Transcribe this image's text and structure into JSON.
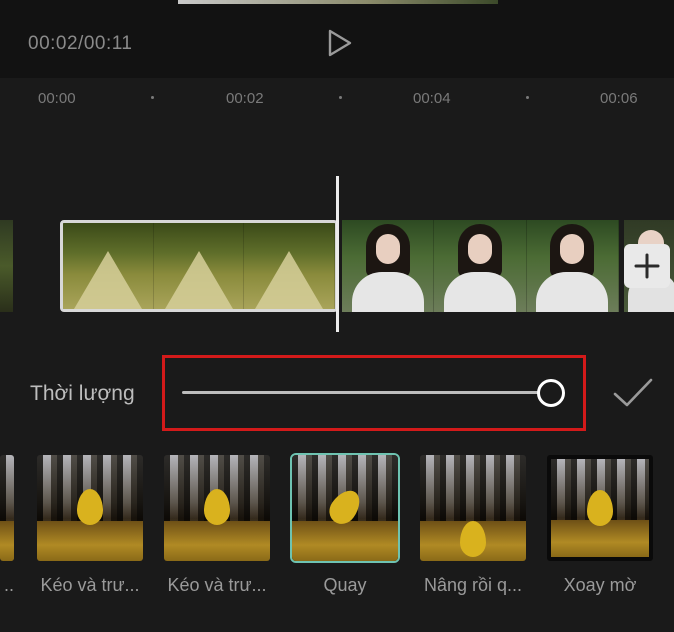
{
  "player": {
    "current_time": "00:02",
    "total_time": "00:11",
    "time_readout": "00:02/00:11"
  },
  "timeline": {
    "ruler": [
      "00:00",
      "00:02",
      "00:04",
      "00:06"
    ]
  },
  "duration": {
    "label": "Thời lượng",
    "slider_value": 1.0
  },
  "colors": {
    "highlight": "#d31a1a",
    "selected_border": "#6ec3b1",
    "background": "#1a1a1a"
  },
  "effects": {
    "partial_label": "..",
    "items": [
      {
        "label": "Kéo và trư..."
      },
      {
        "label": "Kéo và trư..."
      },
      {
        "label": "Quay",
        "selected": true
      },
      {
        "label": "Nâng rồi q..."
      },
      {
        "label": "Xoay mờ"
      }
    ]
  },
  "icons": {
    "play": "play-icon",
    "add": "plus-icon",
    "confirm": "check-icon"
  }
}
